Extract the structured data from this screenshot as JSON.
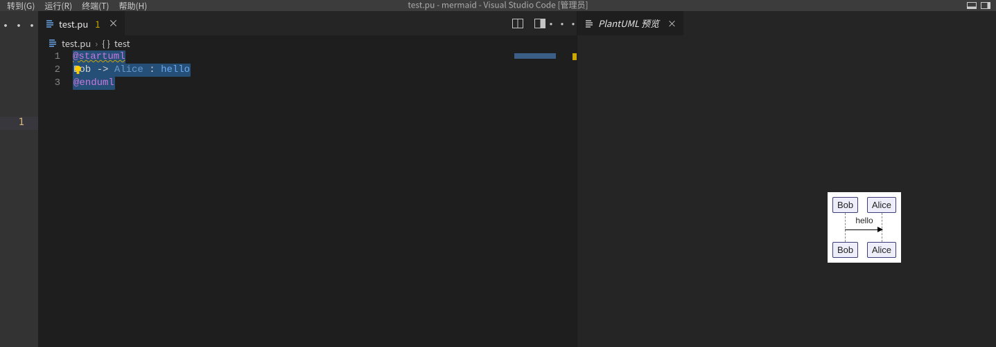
{
  "titlebar": {
    "menu": [
      "转到(G)",
      "运行(R)",
      "终端(T)",
      "帮助(H)"
    ],
    "title": "test.pu - mermaid - Visual Studio Code [管理员]"
  },
  "activitybar": {
    "ellipsis": "···"
  },
  "far_left_hit": "1",
  "editor": {
    "tab": {
      "filename": "test.pu",
      "badge": "1",
      "close": "×"
    },
    "breadcrumb": {
      "file": "test.pu",
      "sep": "›",
      "symbol": "test",
      "braces": "{ }"
    },
    "lines": {
      "nums": [
        "1",
        "2",
        "3"
      ],
      "l1": "@startuml",
      "l2_a": "Bob",
      "l2_b": " -> ",
      "l2_c": "Alice",
      "l2_d": " : ",
      "l2_e": "hello",
      "l3": "@enduml"
    }
  },
  "preview": {
    "tab": {
      "title": "PlantUML 预览",
      "close": "×"
    },
    "diagram": {
      "actorA": "Bob",
      "actorB": "Alice",
      "message": "hello"
    }
  }
}
